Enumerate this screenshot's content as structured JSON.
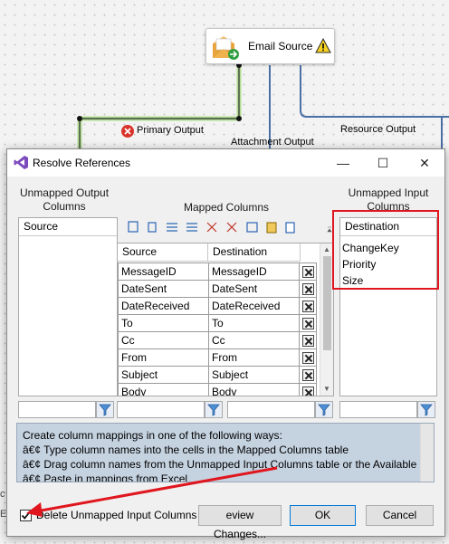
{
  "canvas": {
    "email_source_label": "Email Source",
    "primary_output_label": "Primary Output",
    "attachment_output_label": "Attachment Output",
    "resource_output_label": "Resource Output"
  },
  "dialog": {
    "title": "Resolve References",
    "unmapped_output": {
      "title_line1": "Unmapped Output",
      "title_line2": "Columns",
      "header": "Source"
    },
    "mapped": {
      "title": "Mapped Columns",
      "header_source": "Source",
      "header_destination": "Destination",
      "rows": [
        {
          "source": "MessageID",
          "destination": "MessageID"
        },
        {
          "source": "DateSent",
          "destination": "DateSent"
        },
        {
          "source": "DateReceived",
          "destination": "DateReceived"
        },
        {
          "source": "To",
          "destination": "To"
        },
        {
          "source": "Cc",
          "destination": "Cc"
        },
        {
          "source": "From",
          "destination": "From"
        },
        {
          "source": "Subject",
          "destination": "Subject"
        },
        {
          "source": "Body",
          "destination": "Body"
        }
      ]
    },
    "unmapped_input": {
      "title_line1": "Unmapped Input",
      "title_line2": "Columns",
      "header": "Destination",
      "items": [
        "ChangeKey",
        "Priority",
        "Size"
      ]
    },
    "info_lines": [
      "Create column mappings in one of the following ways:",
      "â€¢ Type column names into the cells in the Mapped Columns table",
      "â€¢ Drag column names from the Unmapped Input Columns table or the Available",
      "â€¢ Paste in mappings from Excel"
    ],
    "checkbox_label": "Delete Unmapped Input Columns",
    "checkbox_checked": true,
    "preview_button": "eview Changes...",
    "ok_button": "OK",
    "cancel_button": "Cancel",
    "minimize_glyph": "—",
    "maximize_glyph": "☐",
    "close_glyph": "✕"
  },
  "colors": {
    "annotation_red": "#e0161e",
    "selected_wire": "#7ac943",
    "wire_blue": "#4a6fa5",
    "info_bg": "#c5d2e0"
  }
}
